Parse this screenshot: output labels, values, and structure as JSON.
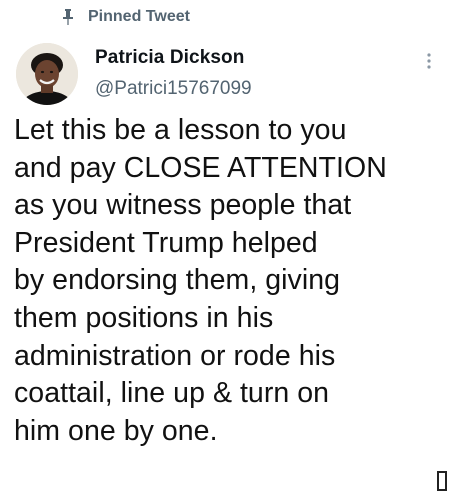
{
  "pinned": {
    "icon": "pin-icon",
    "label": "Pinned Tweet"
  },
  "author": {
    "avatar_icon": "profile-photo",
    "display_name": "Patricia Dickson",
    "handle": "@Patrici15767099"
  },
  "menu": {
    "icon": "more-options-icon"
  },
  "tweet": {
    "lines": [
      "Let this be a lesson to you",
      "and pay CLOSE ATTENTION",
      "as you witness people that",
      "President Trump helped",
      "by endorsing them, giving",
      "them positions in his",
      "administration or rode his",
      "coattail, line up &  turn on",
      "him one by one."
    ]
  },
  "colors": {
    "text": "#0f1419",
    "secondary": "#536471",
    "background": "#ffffff"
  }
}
